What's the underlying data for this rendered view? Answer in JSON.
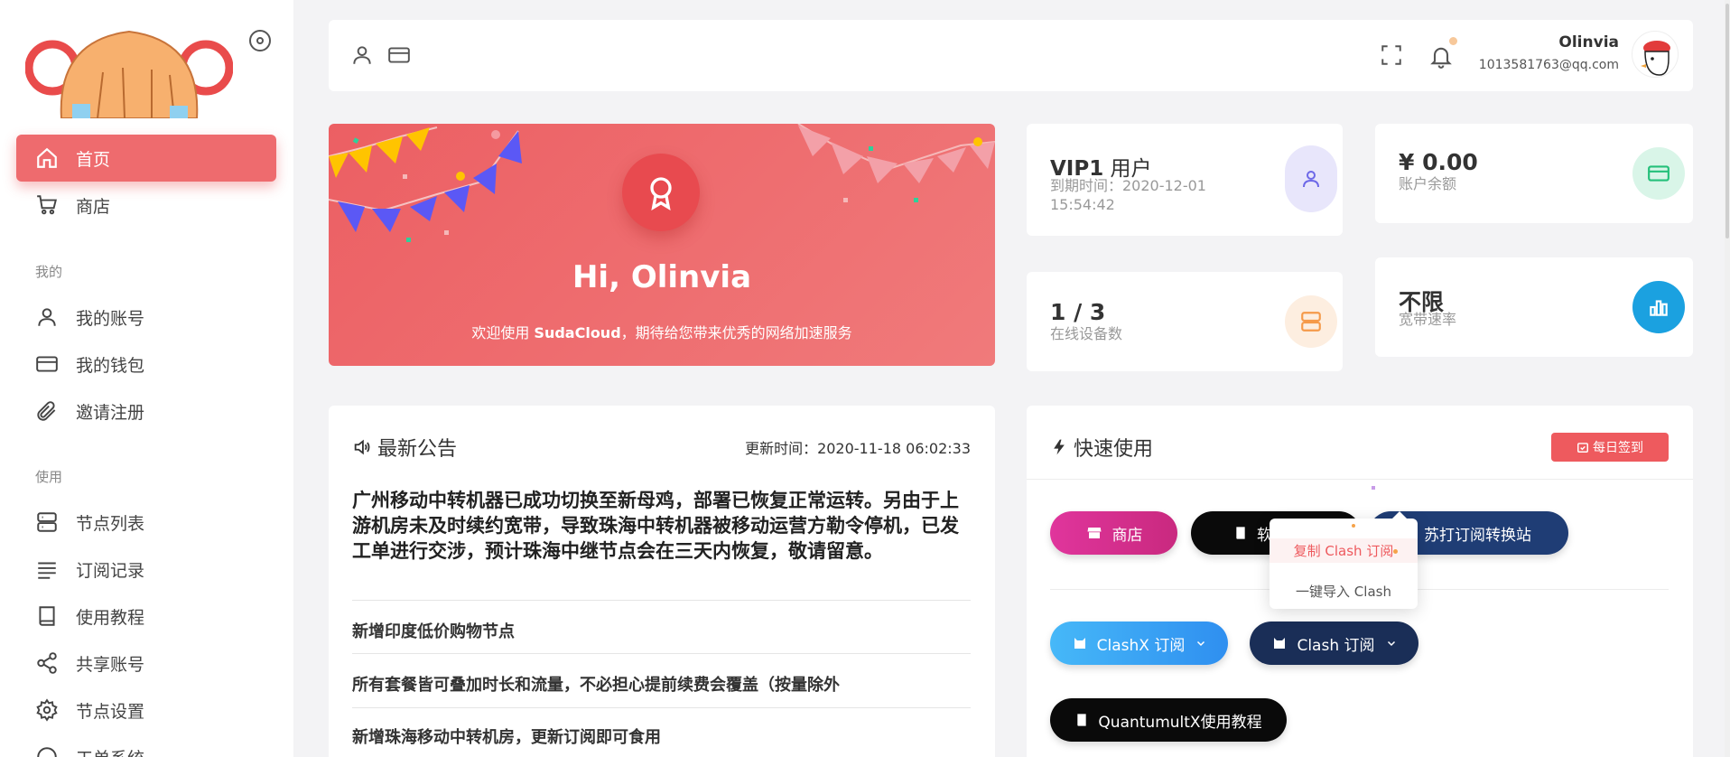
{
  "sidebar": {
    "items": [
      {
        "label": "首页",
        "icon": "home-icon"
      },
      {
        "label": "商店",
        "icon": "cart-icon"
      },
      {
        "label": "我的账号",
        "icon": "user-icon"
      },
      {
        "label": "我的钱包",
        "icon": "wallet-icon"
      },
      {
        "label": "邀请注册",
        "icon": "paperclip-icon"
      },
      {
        "label": "节点列表",
        "icon": "server-icon"
      },
      {
        "label": "订阅记录",
        "icon": "list-icon"
      },
      {
        "label": "使用教程",
        "icon": "book-icon"
      },
      {
        "label": "共享账号",
        "icon": "share-icon"
      },
      {
        "label": "节点设置",
        "icon": "gear-icon"
      },
      {
        "label": "工单系统",
        "icon": "ticket-icon"
      }
    ],
    "sections": {
      "mine": "我的",
      "use": "使用"
    }
  },
  "topbar": {
    "user_name": "Olinvia",
    "user_email": "1013581763@qq.com"
  },
  "welcome": {
    "greeting": "Hi, Olinvia",
    "sub_prefix": "欢迎使用 ",
    "brand": "SudaCloud",
    "sub_suffix": "，期待给您带来优秀的网络加速服务"
  },
  "stats": {
    "vip": {
      "level": "VIP1",
      "suffix": " 用户",
      "expire_label": "到期时间：2020-12-01",
      "expire_time": "15:54:42"
    },
    "balance": {
      "value": "¥ 0.00",
      "label": "账户余额"
    },
    "devices": {
      "value": "1 / 3",
      "label": "在线设备数"
    },
    "bandwidth": {
      "value": "不限",
      "label": "宽带速率"
    }
  },
  "announcement": {
    "title": "最新公告",
    "updated": "更新时间：2020-11-18 06:02:33",
    "headline": "广州移动中转机器已成功切换至新母鸡，部署已恢复正常运转。另由于上游机房未及时续约宽带，导致珠海中转机器被移动运营方勒令停机，已发工单进行交涉，预计珠海中继节点会在三天内恢复，敬请留意。",
    "items": [
      "新增印度低价购物节点",
      "所有套餐皆可叠加时长和流量，不必担心提前续费会覆盖（按量除外",
      "新增珠海移动中转机房，更新订阅即可食用"
    ]
  },
  "quick": {
    "title": "快速使用",
    "sign_in": "每日签到",
    "buttons": {
      "shop": "商店",
      "software": "软件下载",
      "sudacloud_convert": "苏打订阅转换站",
      "clashx": "ClashX 订阅",
      "clash": "Clash 订阅",
      "quantumult": "QuantumultX使用教程"
    },
    "dropdown": {
      "copy": "复制 Clash 订阅",
      "import": "一键导入 Clash"
    }
  },
  "colors": {
    "accent": "#ee6b6e",
    "shop_pill": "#d6318f",
    "dark_pill": "#0a0a0a",
    "navy_pill": "#1e3a6e",
    "clashx_pill": "#3aa8f5"
  }
}
